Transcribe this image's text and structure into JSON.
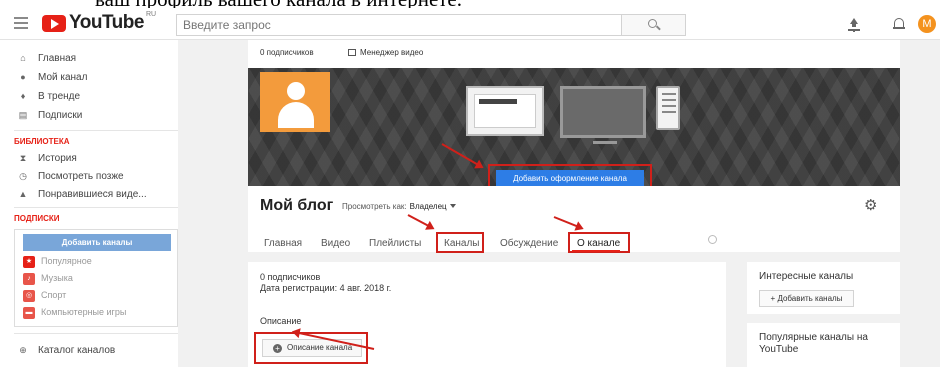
{
  "caption_text": "ваш профиль вашего канала в интернете.",
  "header": {
    "logo_text": "YouTube",
    "logo_region": "RU",
    "search_placeholder": "Введите запрос",
    "avatar_letter": "M"
  },
  "sidebar": {
    "nav_items": [
      {
        "label": "Главная",
        "icon": "home-icon"
      },
      {
        "label": "Мой канал",
        "icon": "user-icon"
      },
      {
        "label": "В тренде",
        "icon": "flame-icon"
      },
      {
        "label": "Подписки",
        "icon": "subscriptions-icon"
      }
    ],
    "library_heading": "БИБЛИОТЕКА",
    "library_items": [
      {
        "label": "История",
        "icon": "history-icon"
      },
      {
        "label": "Посмотреть позже",
        "icon": "clock-icon"
      },
      {
        "label": "Понравившиеся виде...",
        "icon": "thumbs-up-icon"
      }
    ],
    "subscriptions_heading": "ПОДПИСКИ",
    "add_channels_button": "Добавить каналы",
    "subscriptions": [
      {
        "label": "Популярное",
        "color": "#e62117",
        "icon": "star-icon"
      },
      {
        "label": "Музыка",
        "color": "#e8554a",
        "icon": "music-icon"
      },
      {
        "label": "Спорт",
        "color": "#e8554a",
        "icon": "sport-icon"
      },
      {
        "label": "Компьютерные игры",
        "color": "#e8554a",
        "icon": "gamepad-icon"
      }
    ],
    "catalog_item": "Каталог каналов"
  },
  "channel": {
    "subscribers_top": "0 подписчиков",
    "video_manager": "Менеджер видео",
    "add_art_button": "Добавить оформление канала",
    "title": "Мой блог",
    "view_as_label": "Просмотреть как:",
    "view_as_value": "Владелец",
    "tabs": [
      "Главная",
      "Видео",
      "Плейлисты",
      "Каналы",
      "Обсуждение",
      "О канале"
    ],
    "active_tab": "О канале"
  },
  "about": {
    "subscribers": "0 подписчиков",
    "registered": "Дата регистрации: 4 авг. 2018 г.",
    "description_heading": "Описание",
    "description_button": "Описание канала"
  },
  "right_panel": {
    "interesting_heading": "Интересные каналы",
    "add_channels_button": "+ Добавить каналы",
    "popular_heading": "Популярные каналы на YouTube"
  },
  "colors": {
    "brand_red": "#e62117",
    "annotation_red": "#d0201a",
    "primary_blue": "#2d7de6",
    "avatar_orange": "#f39b3c"
  }
}
